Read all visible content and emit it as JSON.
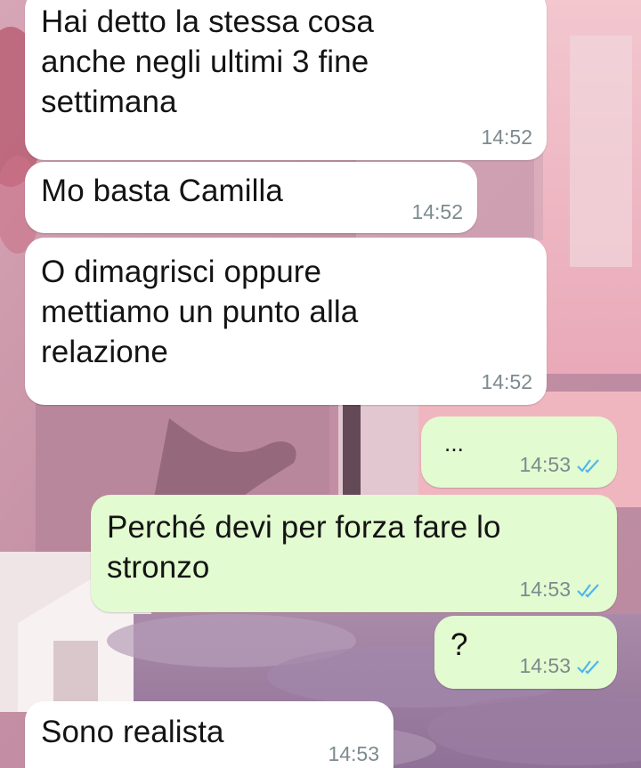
{
  "messages": [
    {
      "direction": "in",
      "text": "Hai detto la stessa cosa\nanche negli ultimi 3 fine\nsettimana",
      "time": "14:52"
    },
    {
      "direction": "in",
      "text": "Mo basta Camilla",
      "time": "14:52"
    },
    {
      "direction": "in",
      "text": "O dimagrisci oppure\nmettiamo un punto alla\nrelazione",
      "time": "14:52"
    },
    {
      "direction": "out",
      "text": "...",
      "time": "14:53",
      "status": "read"
    },
    {
      "direction": "out",
      "text": "Perché devi per forza fare lo\nstronzo",
      "time": "14:53",
      "status": "read"
    },
    {
      "direction": "out",
      "text": "?",
      "time": "14:53",
      "status": "read"
    },
    {
      "direction": "in",
      "text": "Sono realista",
      "time": "14:53"
    }
  ],
  "theme": {
    "incoming_bubble": "#ffffff",
    "outgoing_bubble": "#e2fbd0",
    "read_tick_color": "#4fb6ec",
    "time_color": "#7d8a8e",
    "wallpaper": "pink aesthetic collage"
  }
}
